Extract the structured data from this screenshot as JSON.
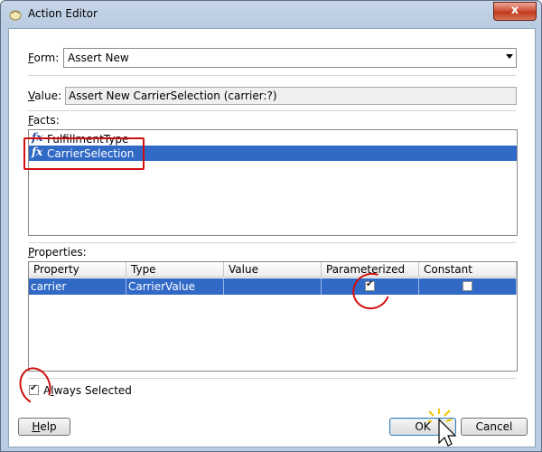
{
  "window": {
    "title": "Action Editor",
    "close_label": "x"
  },
  "form": {
    "label": "Form:",
    "access_key": "F",
    "label_rest": "orm:",
    "selected": "Assert New"
  },
  "value": {
    "label_key": "V",
    "label_rest": "alue:",
    "text": "Assert New CarrierSelection (carrier:?)"
  },
  "facts": {
    "label_key": "F",
    "label_rest": "acts:",
    "items": [
      "FulfillmentType",
      "CarrierSelection"
    ],
    "selected_index": 1
  },
  "properties": {
    "label_key": "P",
    "label_rest": "roperties:",
    "columns": [
      "Property",
      "Type",
      "Value",
      "Parameterized",
      "Constant"
    ],
    "rows": [
      {
        "property": "carrier",
        "type": "CarrierValue",
        "value": "",
        "parameterized": true,
        "constant": false
      }
    ]
  },
  "always_selected": {
    "label_pre": "A",
    "label_key": "l",
    "label_rest": "ways Selected",
    "checked": true
  },
  "buttons": {
    "help_key": "H",
    "help_rest": "elp",
    "ok": "OK",
    "cancel": "Cancel"
  },
  "colors": {
    "selection": "#3169c6",
    "annotation": "#d10f0f"
  }
}
